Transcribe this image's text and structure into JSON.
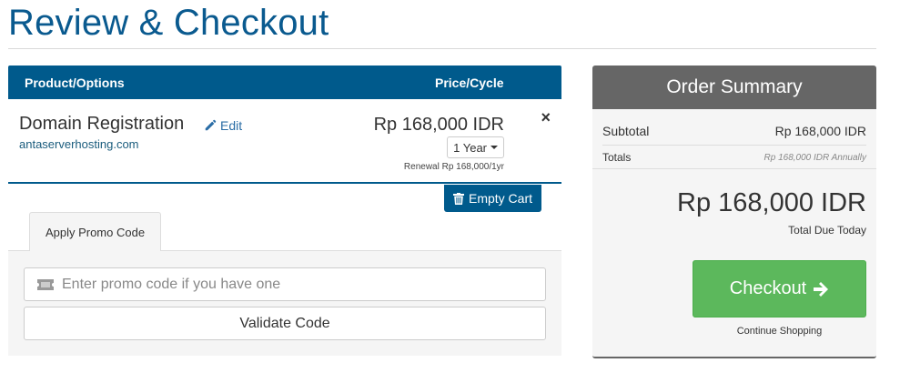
{
  "page": {
    "title": "Review & Checkout"
  },
  "cart": {
    "columns": {
      "product": "Product/Options",
      "price": "Price/Cycle"
    },
    "item": {
      "name": "Domain Registration",
      "edit_label": "Edit",
      "domain": "antaserverhosting.com",
      "price": "Rp 168,000 IDR",
      "cycle": "1 Year",
      "renewal": "Renewal Rp 168,000/1yr",
      "remove_symbol": "×"
    },
    "empty_cart_label": "Empty Cart"
  },
  "promo": {
    "tab_label": "Apply Promo Code",
    "input_placeholder": "Enter promo code if you have one",
    "validate_label": "Validate Code"
  },
  "summary": {
    "title": "Order Summary",
    "subtotal_label": "Subtotal",
    "subtotal_value": "Rp 168,000 IDR",
    "totals_label": "Totals",
    "totals_value": "Rp 168,000 IDR Annually",
    "total_due": "Rp 168,000 IDR",
    "total_due_label": "Total Due Today",
    "checkout_label": "Checkout",
    "continue_label": "Continue Shopping"
  },
  "colors": {
    "brand_blue": "#005a8c",
    "title_blue": "#0a5a8f",
    "checkout_green": "#5cb85c",
    "summary_header": "#666666"
  },
  "icons": {
    "edit": "pencil-icon",
    "remove": "close-icon",
    "empty_cart": "trash-icon",
    "promo": "ticket-icon",
    "checkout": "arrow-right-icon",
    "cycle": "caret-down-icon"
  }
}
